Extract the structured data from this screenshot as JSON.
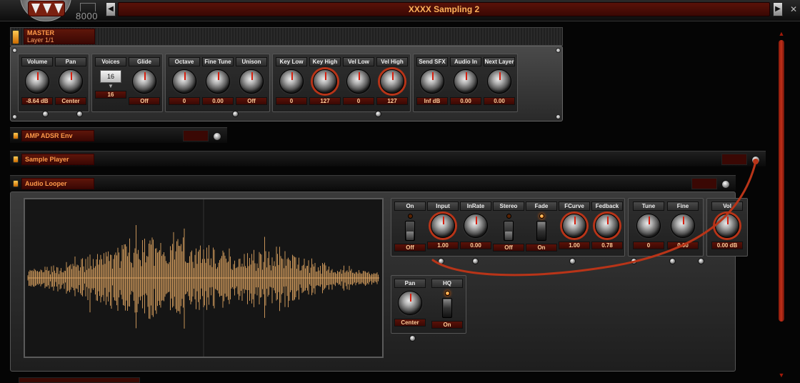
{
  "window": {
    "title": "XXXX Sampling 2",
    "logo_badge": "8000"
  },
  "master": {
    "name": "MASTER",
    "layer": "Layer 1/1",
    "modules": [
      {
        "id": "vol-pan",
        "controls": [
          {
            "label": "Volume",
            "value": "-8.64 dB",
            "type": "knob"
          },
          {
            "label": "Pan",
            "value": "Center",
            "type": "knob"
          }
        ]
      },
      {
        "id": "voices-glide",
        "controls": [
          {
            "label": "Voices",
            "value": "16",
            "box": "16",
            "type": "numbox"
          },
          {
            "label": "Glide",
            "value": "Off",
            "type": "knob"
          }
        ]
      },
      {
        "id": "tuning",
        "controls": [
          {
            "label": "Octave",
            "value": "0",
            "type": "knob"
          },
          {
            "label": "Fine Tune",
            "value": "0.00",
            "type": "knob"
          },
          {
            "label": "Unison",
            "value": "Off",
            "type": "knob"
          }
        ]
      },
      {
        "id": "keyrange",
        "controls": [
          {
            "label": "Key Low",
            "value": "0",
            "type": "knob"
          },
          {
            "label": "Key High",
            "value": "127",
            "type": "knob",
            "ring": true
          },
          {
            "label": "Vel Low",
            "value": "0",
            "type": "knob"
          },
          {
            "label": "Vel High",
            "value": "127",
            "type": "knob",
            "ring": true
          }
        ]
      },
      {
        "id": "sends",
        "controls": [
          {
            "label": "Send SFX",
            "value": "Inf dB",
            "type": "knob"
          },
          {
            "label": "Audio In",
            "value": "0.00",
            "type": "knob"
          },
          {
            "label": "Next Layer",
            "value": "0.00",
            "type": "knob"
          }
        ]
      }
    ]
  },
  "sections": {
    "amp": "AMP ADSR Env",
    "sample_player": "Sample Player",
    "audio_looper": "Audio Looper"
  },
  "looper": {
    "main_controls": [
      {
        "label": "On",
        "value": "Off",
        "type": "switch"
      },
      {
        "label": "Input",
        "value": "1.00",
        "type": "knob",
        "ring": true
      },
      {
        "label": "InRate",
        "value": "0.00",
        "type": "knob"
      },
      {
        "label": "Stereo",
        "value": "Off",
        "type": "switch"
      },
      {
        "label": "Fade",
        "value": "On",
        "type": "switch",
        "led": true
      },
      {
        "label": "FCurve",
        "value": "1.00",
        "type": "knob",
        "ring": true
      },
      {
        "label": "Fedback",
        "value": "0.78",
        "type": "knob",
        "ring": true
      }
    ],
    "tune_controls": [
      {
        "label": "Tune",
        "value": "0",
        "type": "knob"
      },
      {
        "label": "Fine",
        "value": "0.00",
        "type": "knob"
      }
    ],
    "vol_control": {
      "label": "Vol",
      "value": "0.00 dB",
      "type": "knob",
      "ring": true
    },
    "pan_control": {
      "label": "Pan",
      "value": "Center",
      "type": "knob"
    },
    "hq_control": {
      "label": "HQ",
      "value": "On",
      "type": "switch",
      "led": true
    }
  },
  "colors": {
    "accent": "#ff9a4a",
    "waveform": "#d9a060",
    "cable": "#b83418",
    "value_bg": "#4a0c06"
  }
}
